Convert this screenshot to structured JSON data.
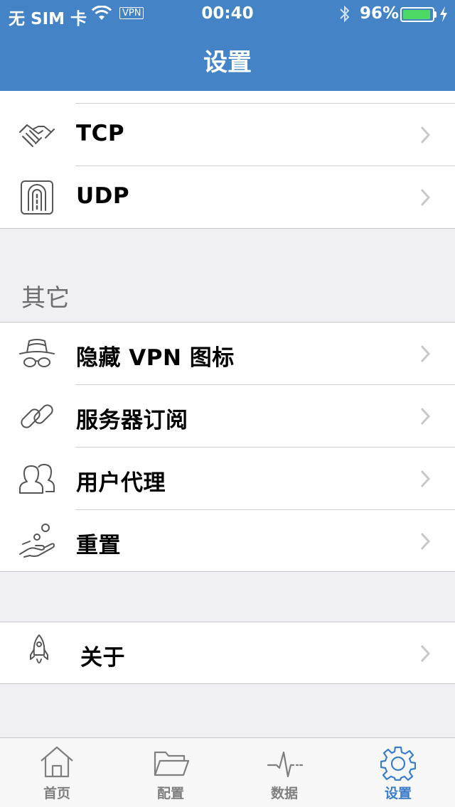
{
  "status_bar": {
    "carrier": "无 SIM 卡",
    "vpn": "VPN",
    "time": "00:40",
    "battery_percent": "96%",
    "battery_level": 0.96
  },
  "nav": {
    "title": "设置"
  },
  "protocols": [
    {
      "label": "TCP",
      "icon": "handshake-icon"
    },
    {
      "label": "UDP",
      "icon": "tunnel-icon"
    }
  ],
  "other_section": {
    "header": "其它",
    "items": [
      {
        "label": "隐藏 VPN 图标",
        "icon": "incognito-icon"
      },
      {
        "label": "服务器订阅",
        "icon": "link-icon"
      },
      {
        "label": "用户代理",
        "icon": "users-icon"
      },
      {
        "label": "重置",
        "icon": "hand-coin-icon"
      }
    ]
  },
  "about": {
    "label": "关于",
    "icon": "rocket-icon"
  },
  "tabbar": {
    "tabs": [
      {
        "label": "首页",
        "icon": "home-icon",
        "active": false
      },
      {
        "label": "配置",
        "icon": "folder-icon",
        "active": false
      },
      {
        "label": "数据",
        "icon": "pulse-icon",
        "active": false
      },
      {
        "label": "设置",
        "icon": "gear-icon",
        "active": true
      }
    ]
  },
  "colors": {
    "accent": "#4383c6",
    "active_tab": "#3a7dc9",
    "battery": "#4cd964",
    "background": "#efeff4"
  }
}
